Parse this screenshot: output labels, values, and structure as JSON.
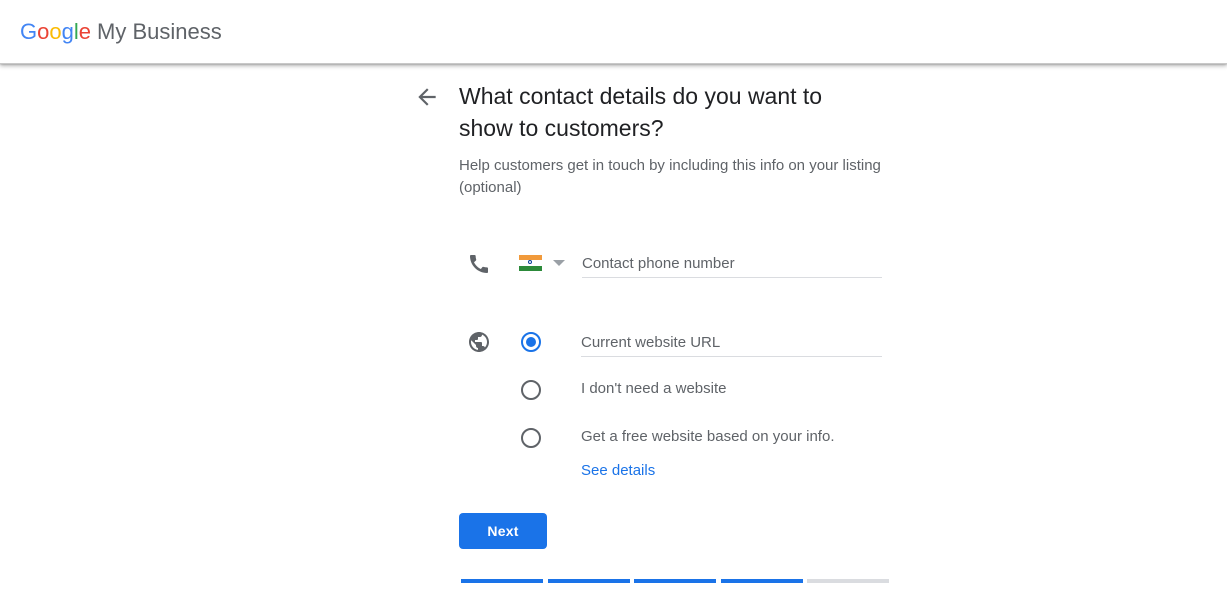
{
  "header": {
    "logo_google": [
      "G",
      "o",
      "o",
      "g",
      "l",
      "e"
    ],
    "logo_product": "My Business",
    "logo_colors": [
      "#4285F4",
      "#EA4335",
      "#FBBC05",
      "#4285F4",
      "#34A853",
      "#EA4335"
    ]
  },
  "main": {
    "title": "What contact details do you want to show to customers?",
    "subtitle": "Help customers get in touch by including this info on your listing (optional)",
    "phone": {
      "icon": "phone-icon",
      "country_flag": "India",
      "placeholder": "Contact phone number",
      "value": ""
    },
    "website": {
      "icon": "globe-icon",
      "options": [
        {
          "label": "",
          "checked": true,
          "input_placeholder": "Current website URL"
        },
        {
          "label": "I don't need a website",
          "checked": false
        },
        {
          "label": "Get a free website based on your info.",
          "checked": false
        }
      ],
      "see_details": "See details"
    },
    "next_button": "Next",
    "progress": {
      "total_steps": 5,
      "completed_steps": 4,
      "active_color": "#1a73e8",
      "inactive_color": "#dadce0"
    }
  },
  "colors": {
    "accent": "#1a73e8",
    "text_primary": "#202124",
    "text_secondary": "#5f6368"
  }
}
